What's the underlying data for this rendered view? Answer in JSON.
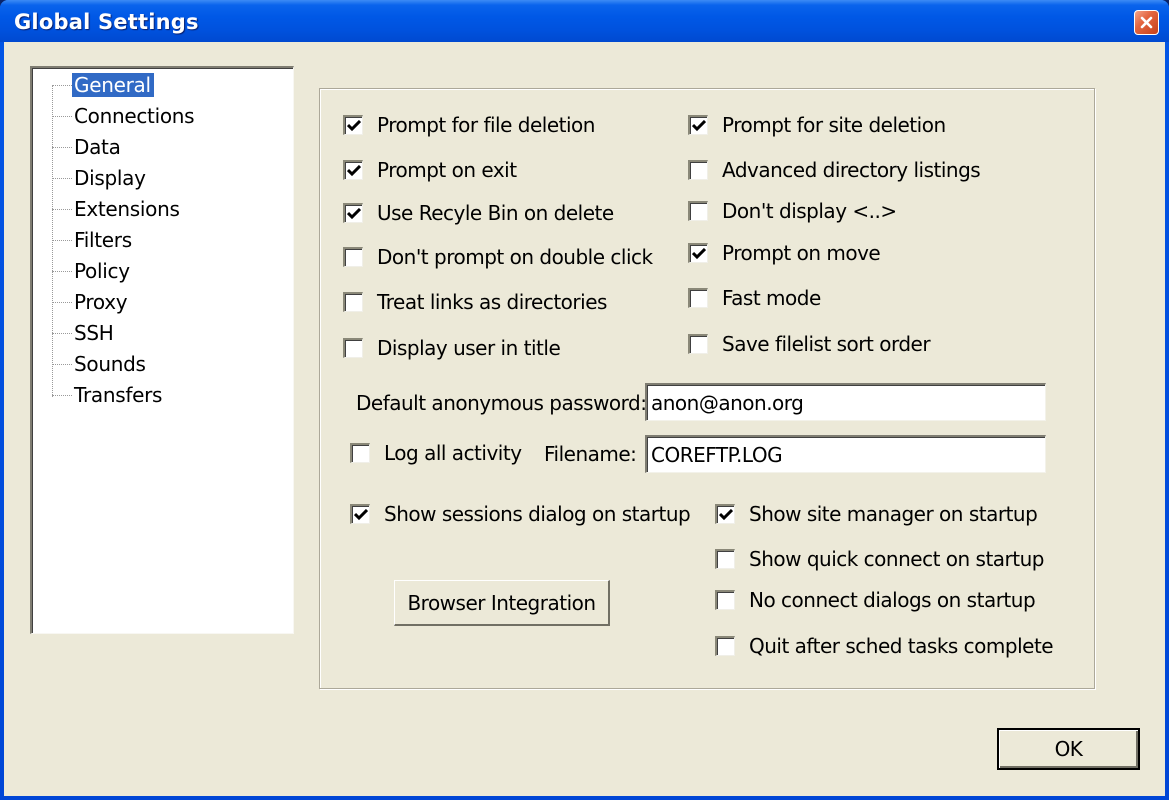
{
  "window": {
    "title": "Global Settings",
    "close_icon": "close-x-icon"
  },
  "tree": {
    "selected": "General",
    "items": [
      {
        "label": "General",
        "selected": true
      },
      {
        "label": "Connections",
        "selected": false
      },
      {
        "label": "Data",
        "selected": false
      },
      {
        "label": "Display",
        "selected": false
      },
      {
        "label": "Extensions",
        "selected": false
      },
      {
        "label": "Filters",
        "selected": false
      },
      {
        "label": "Policy",
        "selected": false
      },
      {
        "label": "Proxy",
        "selected": false
      },
      {
        "label": "SSH",
        "selected": false
      },
      {
        "label": "Sounds",
        "selected": false
      },
      {
        "label": "Transfers",
        "selected": false
      }
    ]
  },
  "options_left": [
    {
      "label": "Prompt for file deletion",
      "checked": true
    },
    {
      "label": "Prompt on exit",
      "checked": true
    },
    {
      "label": "Use Recyle Bin on delete",
      "checked": true
    },
    {
      "label": "Don't prompt on double click",
      "checked": false
    },
    {
      "label": "Treat links as directories",
      "checked": false
    },
    {
      "label": "Display user in title",
      "checked": false
    }
  ],
  "options_right": [
    {
      "label": "Prompt for site deletion",
      "checked": true
    },
    {
      "label": "Advanced directory listings",
      "checked": false
    },
    {
      "label": "Don't display <..>",
      "checked": false
    },
    {
      "label": "Prompt on move",
      "checked": true
    },
    {
      "label": "Fast mode",
      "checked": false
    },
    {
      "label": "Save filelist sort order",
      "checked": false
    }
  ],
  "anon_password": {
    "label": "Default anonymous password:",
    "value": "anon@anon.org"
  },
  "logging": {
    "log_all_label": "Log all activity",
    "log_all_checked": false,
    "filename_label": "Filename:",
    "filename_value": "COREFTP.LOG"
  },
  "startup_left": {
    "label": "Show sessions dialog on startup",
    "checked": true
  },
  "startup_right": [
    {
      "label": "Show site manager on startup",
      "checked": true
    },
    {
      "label": "Show quick connect on startup",
      "checked": false
    },
    {
      "label": "No connect dialogs on startup",
      "checked": false
    },
    {
      "label": "Quit after sched tasks complete",
      "checked": false
    }
  ],
  "buttons": {
    "browser_integration": "Browser Integration",
    "ok": "OK"
  }
}
